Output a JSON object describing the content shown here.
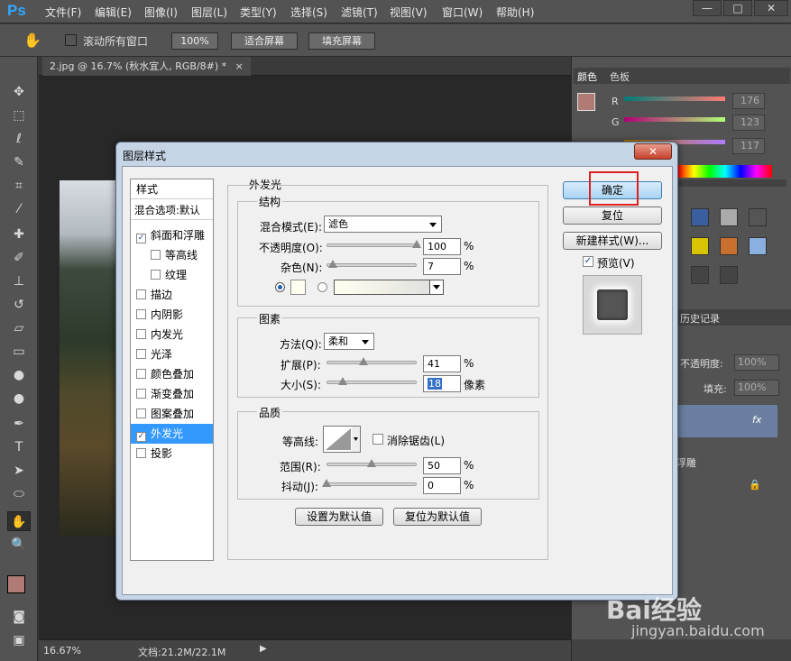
{
  "app": {
    "logo": "Ps"
  },
  "menu": [
    "文件(F)",
    "编辑(E)",
    "图像(I)",
    "图层(L)",
    "类型(Y)",
    "选择(S)",
    "滤镜(T)",
    "视图(V)",
    "窗口(W)",
    "帮助(H)"
  ],
  "window_controls": {
    "minimize": "—",
    "maximize": "□",
    "close": "✕"
  },
  "options": {
    "scroll_all_label": "滚动所有窗口",
    "zoom_100": "100%",
    "fit_screen": "适合屏幕",
    "fill_screen": "填充屏幕"
  },
  "document": {
    "tab_title": "2.jpg @ 16.7% (秋水宜人, RGB/8#) *",
    "tab_close": "×"
  },
  "status": {
    "zoom": "16.67%",
    "doc_info": "文档:21.2M/22.1M"
  },
  "color_panel": {
    "tab_color": "颜色",
    "tab_swatches": "色板",
    "r_label": "R",
    "g_label": "G",
    "r_value": "176",
    "g_value": "123",
    "b_value": "117",
    "fg_color": "#b07b75"
  },
  "layers_panel": {
    "history_tab": "历史记录",
    "opacity_label": "不透明度:",
    "opacity_value": "100%",
    "fill_label": "填充:",
    "fill_value": "100%",
    "fx_label": "fx",
    "effect_name": "浮雕"
  },
  "dialog": {
    "title": "图层样式",
    "close": "✕",
    "styles_header": "样式",
    "blend_options": "混合选项:默认",
    "styles": [
      {
        "label": "斜面和浮雕",
        "checked": true
      },
      {
        "label": "等高线",
        "checked": false
      },
      {
        "label": "纹理",
        "checked": false
      },
      {
        "label": "描边",
        "checked": false
      },
      {
        "label": "内阴影",
        "checked": false
      },
      {
        "label": "内发光",
        "checked": false
      },
      {
        "label": "光泽",
        "checked": false
      },
      {
        "label": "颜色叠加",
        "checked": false
      },
      {
        "label": "渐变叠加",
        "checked": false
      },
      {
        "label": "图案叠加",
        "checked": false
      },
      {
        "label": "外发光",
        "checked": true
      },
      {
        "label": "投影",
        "checked": false
      }
    ],
    "section_title": "外发光",
    "structure": {
      "title": "结构",
      "blend_mode_label": "混合模式(E):",
      "blend_mode_value": "滤色",
      "opacity_label": "不透明度(O):",
      "opacity_value": "100",
      "opacity_level": 1.0,
      "noise_label": "杂色(N):",
      "noise_value": "7",
      "noise_level": 0.07,
      "percent": "%"
    },
    "elements": {
      "title": "图素",
      "technique_label": "方法(Q):",
      "technique_value": "柔和",
      "spread_label": "扩展(P):",
      "spread_value": "41",
      "spread_level": 0.41,
      "size_label": "大小(S):",
      "size_value": "18",
      "size_level": 0.18,
      "size_unit": "像素",
      "percent": "%"
    },
    "quality": {
      "title": "品质",
      "contour_label": "等高线:",
      "antialias_label": "消除锯齿(L)",
      "range_label": "范围(R):",
      "range_value": "50",
      "range_level": 0.5,
      "jitter_label": "抖动(J):",
      "jitter_value": "0",
      "jitter_level": 0.0,
      "percent": "%"
    },
    "make_default": "设置为默认值",
    "reset_default": "复位为默认值",
    "ok": "确定",
    "reset": "复位",
    "new_style": "新建样式(W)...",
    "preview_label": "预览(V)",
    "preview_checked": true
  },
  "watermark": {
    "brand": "Bai经验",
    "url": "jingyan.baidu.com"
  }
}
